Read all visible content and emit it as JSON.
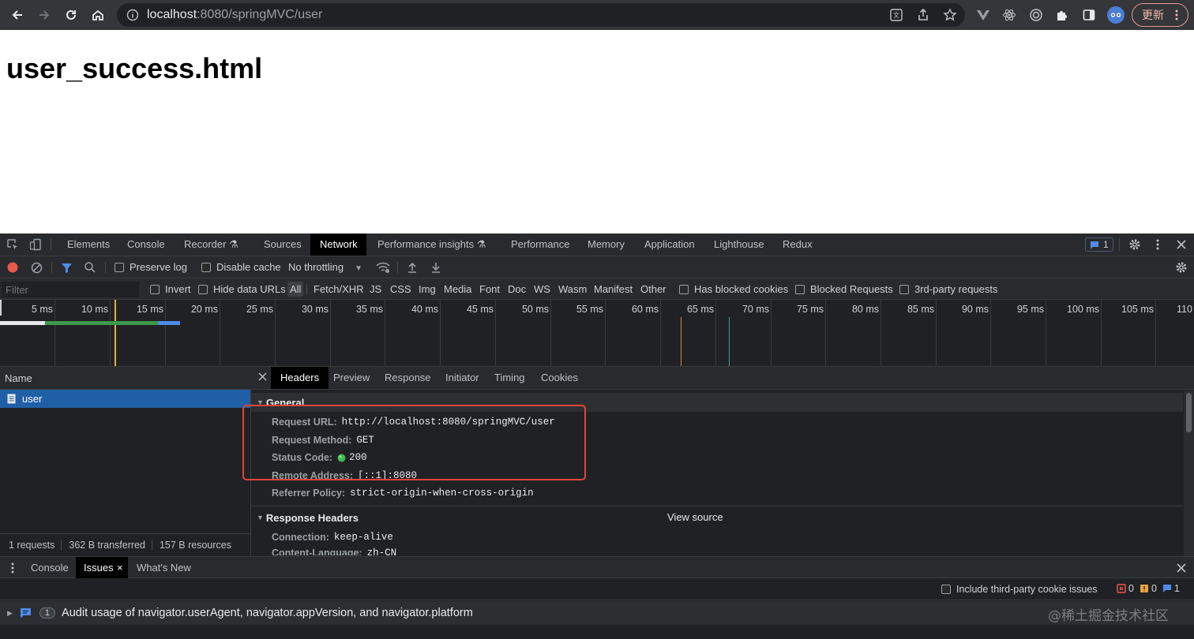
{
  "browser": {
    "url_host": "localhost",
    "url_rest": ":8080/springMVC/user",
    "update_label": "更新"
  },
  "page": {
    "heading": "user_success.html"
  },
  "devtools": {
    "tabs": [
      {
        "label": "Elements"
      },
      {
        "label": "Console"
      },
      {
        "label": "Recorder ⚗"
      },
      {
        "label": "Sources"
      },
      {
        "label": "Network"
      },
      {
        "label": "Performance insights ⚗"
      },
      {
        "label": "Performance"
      },
      {
        "label": "Memory"
      },
      {
        "label": "Application"
      },
      {
        "label": "Lighthouse"
      },
      {
        "label": "Redux"
      }
    ],
    "issues_badge_count": "1",
    "toolbar": {
      "preserve_log": "Preserve log",
      "disable_cache": "Disable cache",
      "throttling": "No throttling"
    },
    "filter": {
      "placeholder": "Filter",
      "invert": "Invert",
      "hide_data_urls": "Hide data URLs",
      "types": [
        "All",
        "Fetch/XHR",
        "JS",
        "CSS",
        "Img",
        "Media",
        "Font",
        "Doc",
        "WS",
        "Wasm",
        "Manifest",
        "Other"
      ],
      "has_blocked_cookies": "Has blocked cookies",
      "blocked_requests": "Blocked Requests",
      "third_party": "3rd-party requests"
    },
    "timeline_ticks": [
      "5 ms",
      "10 ms",
      "15 ms",
      "20 ms",
      "25 ms",
      "30 ms",
      "35 ms",
      "40 ms",
      "45 ms",
      "50 ms",
      "55 ms",
      "60 ms",
      "65 ms",
      "70 ms",
      "75 ms",
      "80 ms",
      "85 ms",
      "90 ms",
      "95 ms",
      "100 ms",
      "105 ms",
      "110"
    ],
    "request_list": {
      "column_name": "Name",
      "requests": [
        {
          "name": "user"
        }
      ],
      "summary": {
        "requests": "1 requests",
        "transferred": "362 B transferred",
        "resources": "157 B resources"
      }
    },
    "detail_tabs": [
      "Headers",
      "Preview",
      "Response",
      "Initiator",
      "Timing",
      "Cookies"
    ],
    "general": {
      "title": "General",
      "rows": [
        {
          "key": "Request URL:",
          "value": "http://localhost:8080/springMVC/user"
        },
        {
          "key": "Request Method:",
          "value": "GET"
        },
        {
          "key": "Status Code:",
          "value": "200"
        },
        {
          "key": "Remote Address:",
          "value": "[::1]:8080"
        },
        {
          "key": "Referrer Policy:",
          "value": "strict-origin-when-cross-origin"
        }
      ]
    },
    "response_headers": {
      "title": "Response Headers",
      "view_source": "View source",
      "rows": [
        {
          "key": "Connection:",
          "value": "keep-alive"
        },
        {
          "key": "Content-Language:",
          "value": "zh-CN"
        }
      ]
    },
    "drawer": {
      "tabs": [
        "Console",
        "Issues",
        "What's New"
      ],
      "include_third_party": "Include third-party cookie issues",
      "counts": {
        "errors": "0",
        "warnings": "0",
        "info": "1"
      },
      "issue": {
        "count": "1",
        "text": "Audit usage of navigator.userAgent, navigator.appVersion, and navigator.platform"
      }
    },
    "watermark": "@稀土掘金技术社区",
    "colors": {
      "selected_row": "#1f5fa6",
      "highlight_box": "#e0463a",
      "status_green": "#3fb950"
    }
  }
}
